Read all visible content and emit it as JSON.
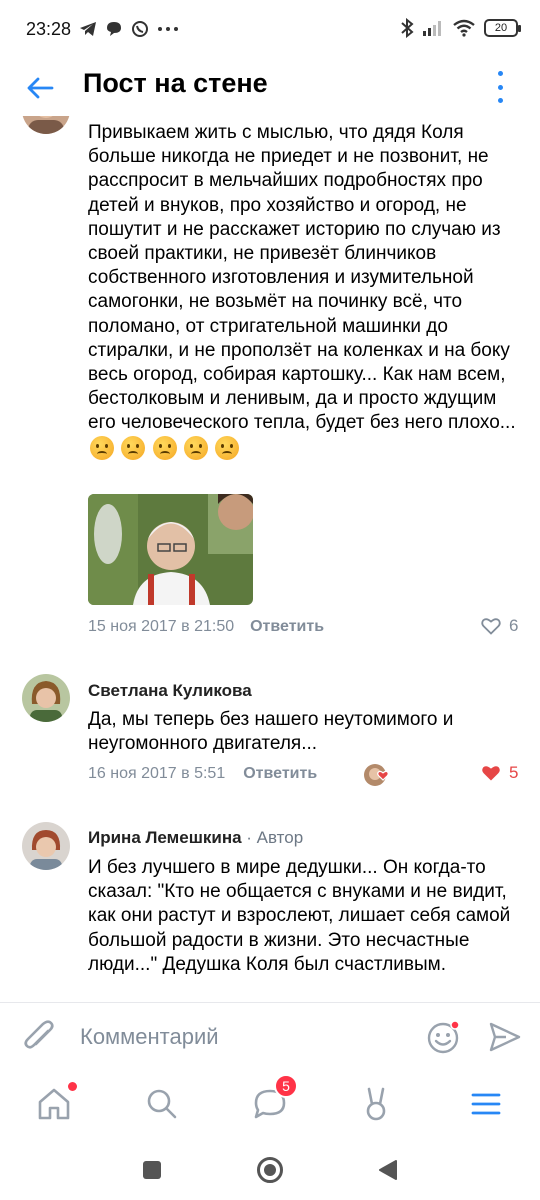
{
  "status_bar": {
    "time": "23:28",
    "battery": "20"
  },
  "header": {
    "title": "Пост на стене"
  },
  "comments": [
    {
      "text": "Привыкаем жить с мыслью, что дядя Коля больше никогда не приедет и не позвонит, не расспросит в мельчайших подробностях про детей и внуков, про хозяйство и огород, не пошутит и не расскажет историю по случаю из своей практики, не привезёт блинчиков собственного изготовления и изумительной самогонки, не возьмёт на починку всё, что поломано, от стригательной машинки до стиралки, и не проползёт на коленках и на боку весь огород, собирая картошку... Как нам всем, бестолковым и ленивым, да и просто ждущим его человеческого тепла, будет без него плохо...",
      "date": "15 ноя 2017 в 21:50",
      "reply": "Ответить",
      "likes": "6"
    },
    {
      "author": "Светлана Куликова",
      "text": "Да,  мы теперь без нашего неутомимого и неугомонного двигателя...",
      "date": "16 ноя 2017 в 5:51",
      "reply": "Ответить",
      "likes": "5"
    },
    {
      "author": "Ирина Лемешкина",
      "author_tag": "· Автор",
      "text": "И без лучшего в мире дедушки... Он когда-то сказал: \"Кто не общается с внуками и не видит, как они растут и взрослеют, лишает себя самой большой радости в жизни. Это несчастные люди...\" Дедушка Коля был счастливым."
    }
  ],
  "composer": {
    "placeholder": "Комментарий"
  },
  "bottom_nav": {
    "messages_badge": "5"
  },
  "colors": {
    "accent": "#2787f5",
    "like_active": "#e64646",
    "badge": "#ff3347",
    "meta_text": "#818c99"
  }
}
